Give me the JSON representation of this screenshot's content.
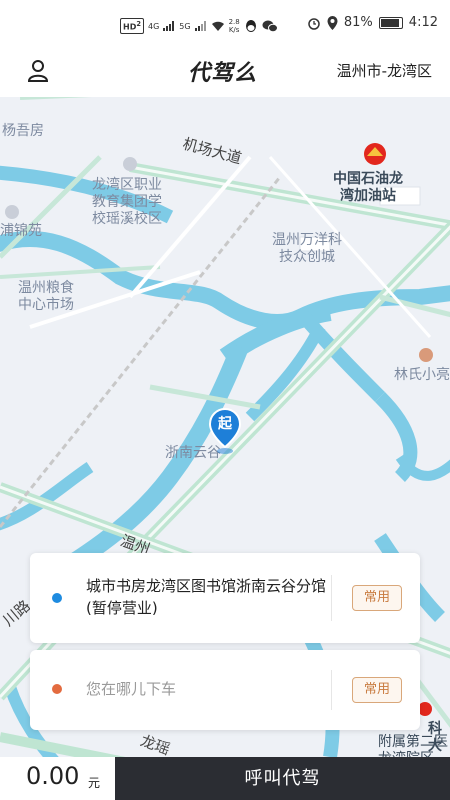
{
  "status_bar": {
    "hd_badge": "HD",
    "hd_num": "2",
    "net1": "4G",
    "net2": "5G",
    "speed_value": "2.8",
    "speed_unit": "K/s",
    "battery": "81%",
    "battery_level": 0.81,
    "time": "4:12"
  },
  "header": {
    "logo": "代驾么",
    "city": "温州市-龙湾区"
  },
  "map": {
    "labels": {
      "yang_wu_fang": "杨吾房",
      "airport_road": "机场大道",
      "gas_station": "中国石油龙\n湾加油站",
      "school": "龙湾区职业\n教育集团学\n校瑶溪校区",
      "jin_yuan": "浦锦苑",
      "wanyang": "温州万洋科\n技众创城",
      "grain_market": "温州粮食\n中心市场",
      "lin_shi": "林氏小亮",
      "zhe_nan": "浙南云谷",
      "wenzhou_road": "温州",
      "chuan_road": "川路",
      "longyao": "龙瑶",
      "hospital": "附属第二医\n龙湾院区",
      "hospital2": "科大"
    },
    "start_marker": "起"
  },
  "trip": {
    "origin": "城市书房龙湾区图书馆浙南云谷分馆(暂停营业)",
    "origin_dot_color": "#1e8be0",
    "destination_placeholder": "您在哪儿下车",
    "dest_dot_color": "#e36b3f",
    "favorite_label": "常用",
    "favorite_label2": "常用"
  },
  "footer": {
    "price": "0.00",
    "price_unit": "元",
    "call_button": "呼叫代驾"
  }
}
